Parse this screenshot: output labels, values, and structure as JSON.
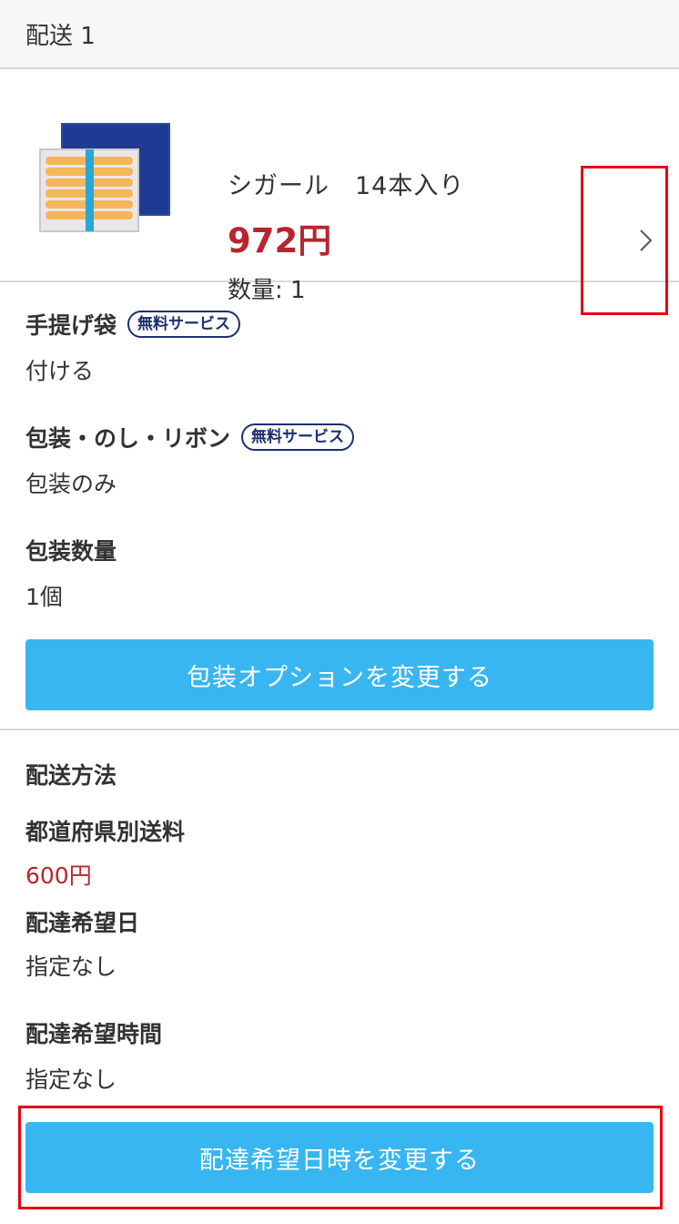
{
  "header": {
    "title": "配送 1"
  },
  "product": {
    "name": "シガール　14本入り",
    "price": "972円",
    "quantity": "数量: 1",
    "image_alt": "cigare-box-image"
  },
  "wrapping": {
    "bag_label": "手提げ袋",
    "bag_badge": "無料サービス",
    "bag_value": "付ける",
    "packaging_label": "包装・のし・リボン",
    "packaging_badge": "無料サービス",
    "packaging_value": "包装のみ",
    "count_label": "包装数量",
    "count_value": "1個",
    "change_button": "包装オプションを変更する"
  },
  "shipping": {
    "method_label": "配送方法",
    "fee_label": "都道府県別送料",
    "fee_value": "600円",
    "date_label": "配達希望日",
    "date_value": "指定なし",
    "time_label": "配達希望時間",
    "time_value": "指定なし",
    "change_button": "配達希望日時を変更する"
  },
  "colors": {
    "price_red": "#b8252d",
    "button_blue": "#38b6f1",
    "highlight_red": "#e60012",
    "badge_navy": "#1d2f6f"
  },
  "icons": {
    "chevron": "chevron-right-icon"
  }
}
